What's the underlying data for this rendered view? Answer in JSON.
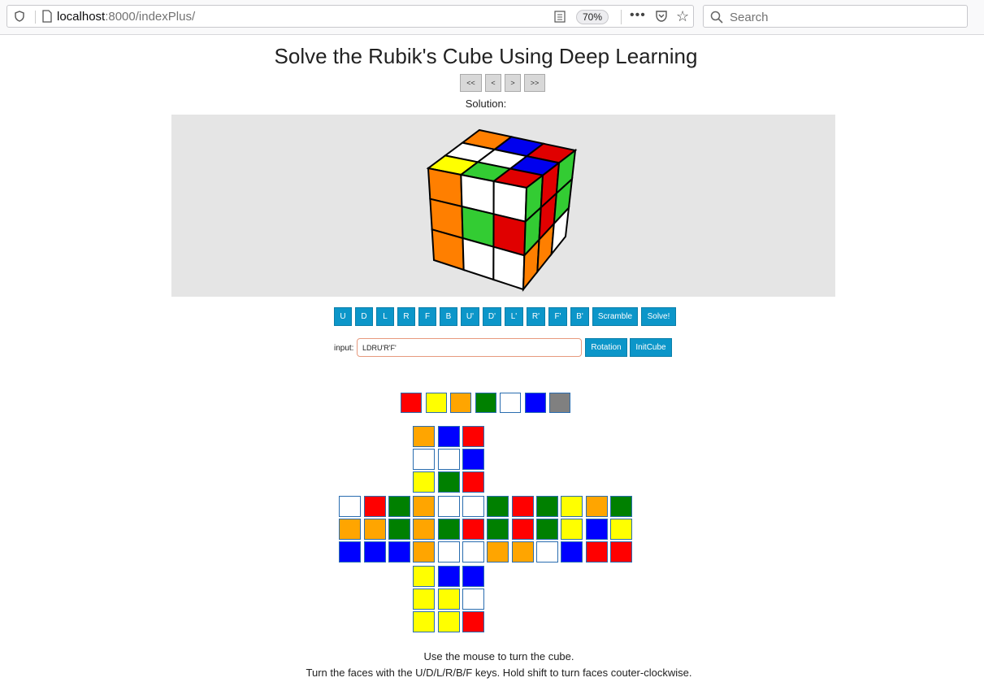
{
  "browser": {
    "url_host": "localhost",
    "url_path": ":8000/indexPlus/",
    "zoom": "70%",
    "more_label": "•••",
    "search_placeholder": "Search"
  },
  "page": {
    "title": "Solve the Rubik's Cube Using Deep Learning",
    "nav": {
      "first": "<<",
      "prev": "<",
      "next": ">",
      "last": ">>"
    },
    "solution_label": "Solution:",
    "moves": [
      "U",
      "D",
      "L",
      "R",
      "F",
      "B",
      "U'",
      "D'",
      "L'",
      "R'",
      "F'",
      "B'"
    ],
    "scramble_label": "Scramble",
    "solve_label": "Solve!",
    "input_label": "input:",
    "input_value": "LDRU'R'F'",
    "rotation_label": "Rotation",
    "initcube_label": "InitCube",
    "help_line1": "Use the mouse to turn the cube.",
    "help_line2": "Turn the faces with the U/D/L/R/B/F keys. Hold shift to turn faces couter-clockwise."
  },
  "colors": {
    "red": "#ff0000",
    "yellow": "#ffff00",
    "orange": "#ffa500",
    "green": "#008000",
    "white": "#ffffff",
    "blue": "#0000ff",
    "gray": "#808080",
    "button": "#0c96c9"
  },
  "palette": [
    "red",
    "yellow",
    "orange",
    "green",
    "white",
    "blue",
    "gray"
  ],
  "cube_faces": {
    "U": [
      [
        "orange",
        "blue",
        "red"
      ],
      [
        "white",
        "white",
        "blue"
      ],
      [
        "yellow",
        "green",
        "red"
      ]
    ],
    "L": [
      [
        "white",
        "red",
        "green"
      ],
      [
        "orange",
        "orange",
        "green"
      ],
      [
        "blue",
        "blue",
        "blue"
      ]
    ],
    "F": [
      [
        "orange",
        "white",
        "white"
      ],
      [
        "orange",
        "green",
        "red"
      ],
      [
        "orange",
        "white",
        "white"
      ]
    ],
    "R": [
      [
        "green",
        "red",
        "green"
      ],
      [
        "green",
        "red",
        "green"
      ],
      [
        "orange",
        "orange",
        "white"
      ]
    ],
    "B": [
      [
        "yellow",
        "orange",
        "green"
      ],
      [
        "yellow",
        "blue",
        "yellow"
      ],
      [
        "blue",
        "red",
        "red"
      ]
    ],
    "D": [
      [
        "yellow",
        "blue",
        "blue"
      ],
      [
        "yellow",
        "yellow",
        "white"
      ],
      [
        "yellow",
        "yellow",
        "red"
      ]
    ]
  },
  "cube_3d": {
    "top": [
      [
        "orange",
        "blue",
        "red"
      ],
      [
        "white",
        "white",
        "blue"
      ],
      [
        "yellow",
        "green",
        "red"
      ]
    ],
    "front": [
      [
        "orange",
        "white",
        "white"
      ],
      [
        "orange",
        "green",
        "red"
      ],
      [
        "orange",
        "white",
        "white"
      ]
    ],
    "right": [
      [
        "green",
        "red",
        "green"
      ],
      [
        "green",
        "red",
        "green"
      ],
      [
        "orange",
        "orange",
        "white"
      ]
    ]
  }
}
